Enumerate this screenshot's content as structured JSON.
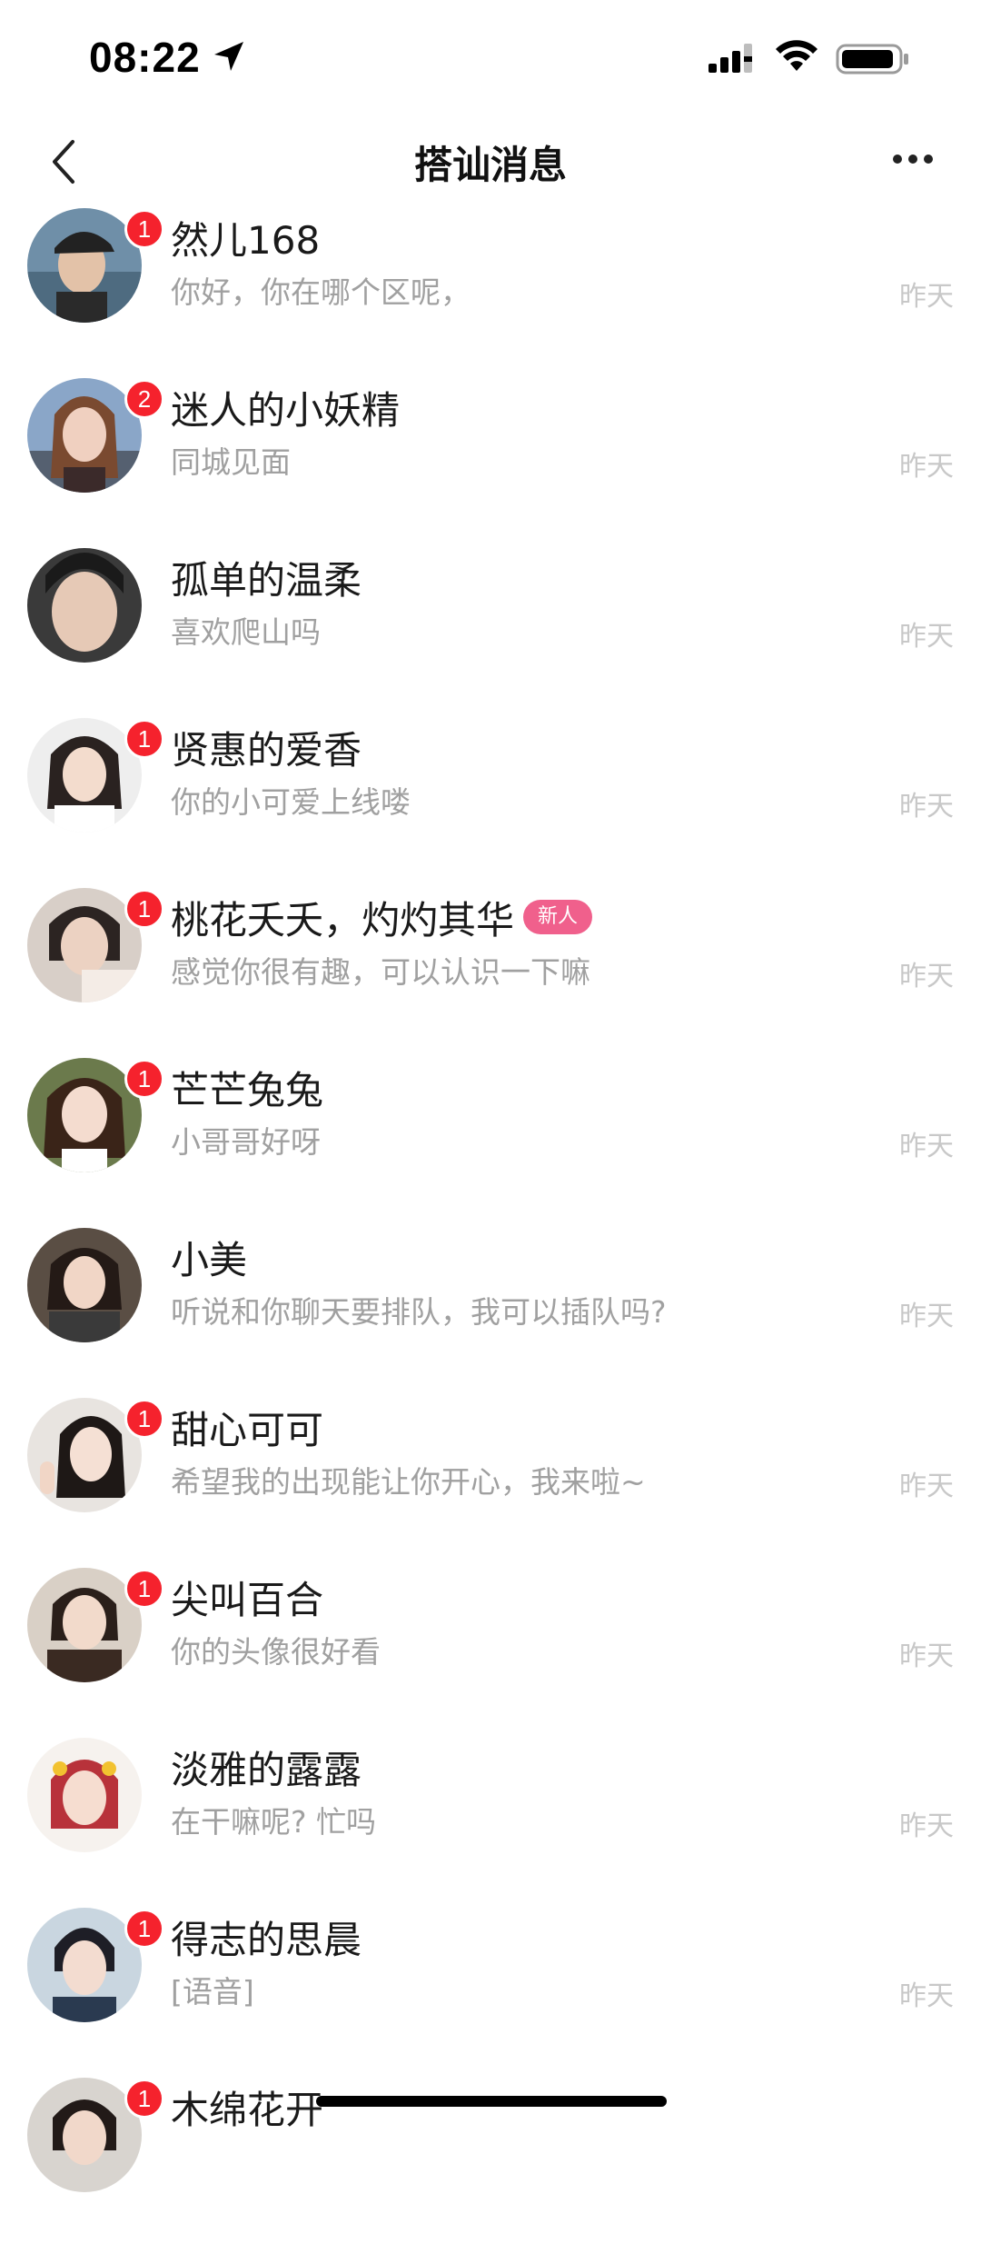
{
  "status_bar": {
    "time": "08:22"
  },
  "header": {
    "title": "搭讪消息"
  },
  "colors": {
    "badge": "#f5222d",
    "new_tag": "#f0608c",
    "preview_text": "#a0a0a0",
    "time_text": "#c8c8c8"
  },
  "messages": [
    {
      "name": "然儿168",
      "preview": "你好，你在哪个区呢，",
      "time": "昨天",
      "badge": "1"
    },
    {
      "name": "迷人的小妖精",
      "preview": "同城见面",
      "time": "昨天",
      "badge": "2"
    },
    {
      "name": "孤单的温柔",
      "preview": "喜欢爬山吗",
      "time": "昨天",
      "badge": ""
    },
    {
      "name": "贤惠的爱香",
      "preview": "你的小可爱上线喽",
      "time": "昨天",
      "badge": "1"
    },
    {
      "name": "桃花夭夭，灼灼其华",
      "tag": "新人",
      "preview": "感觉你很有趣，可以认识一下嘛",
      "time": "昨天",
      "badge": "1"
    },
    {
      "name": "芒芒兔兔",
      "preview": "小哥哥好呀",
      "time": "昨天",
      "badge": "1"
    },
    {
      "name": "小美",
      "preview": "听说和你聊天要排队，我可以插队吗?",
      "time": "昨天",
      "badge": ""
    },
    {
      "name": "甜心可可",
      "preview": "希望我的出现能让你开心，我来啦~",
      "time": "昨天",
      "badge": "1"
    },
    {
      "name": "尖叫百合",
      "preview": "你的头像很好看",
      "time": "昨天",
      "badge": "1"
    },
    {
      "name": "淡雅的露露",
      "preview": "在干嘛呢? 忙吗",
      "time": "昨天",
      "badge": ""
    },
    {
      "name": "得志的思晨",
      "preview": "[语音]",
      "time": "昨天",
      "badge": "1"
    },
    {
      "name": "木绵花开",
      "preview": "",
      "time": "",
      "badge": "1"
    }
  ]
}
